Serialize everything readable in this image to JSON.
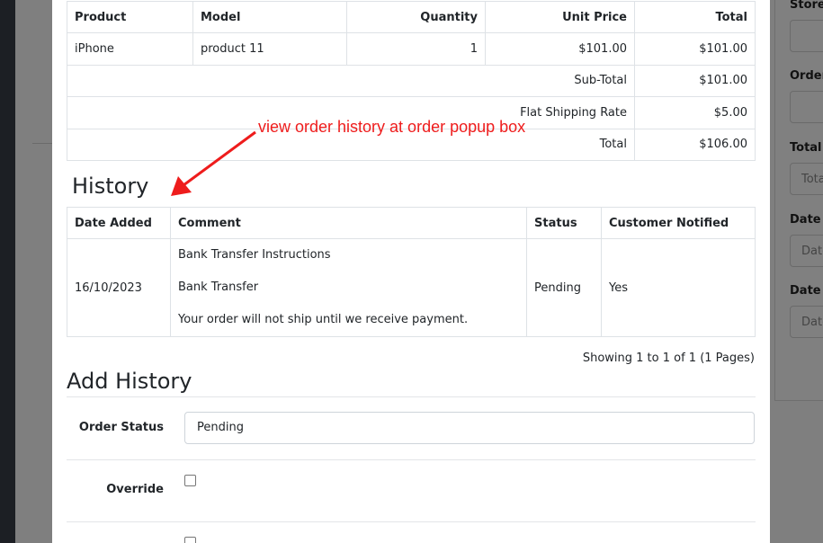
{
  "products_table": {
    "headers": {
      "product": "Product",
      "model": "Model",
      "quantity": "Quantity",
      "unit_price": "Unit Price",
      "total": "Total"
    },
    "rows": [
      {
        "product": "iPhone",
        "model": "product 11",
        "quantity": "1",
        "unit_price": "$101.00",
        "total": "$101.00"
      }
    ],
    "totals": [
      {
        "label": "Sub-Total",
        "value": "$101.00"
      },
      {
        "label": "Flat Shipping Rate",
        "value": "$5.00"
      },
      {
        "label": "Total",
        "value": "$106.00"
      }
    ]
  },
  "annotation": {
    "text": "view order history at order popup box",
    "color": "#ee1c1c"
  },
  "history": {
    "title": "History",
    "headers": {
      "date_added": "Date Added",
      "comment": "Comment",
      "status": "Status",
      "customer_notified": "Customer Notified"
    },
    "rows": [
      {
        "date_added": "16/10/2023",
        "comment_lines": [
          "Bank Transfer Instructions",
          "Bank Transfer",
          "Your order will not ship until we receive payment."
        ],
        "status": "Pending",
        "customer_notified": "Yes"
      }
    ],
    "pagination": "Showing 1 to 1 of 1 (1 Pages)"
  },
  "add_history": {
    "title": "Add History",
    "order_status_label": "Order Status",
    "order_status_value": "Pending",
    "override_label": "Override",
    "override_checked": false,
    "notify_checked": false
  },
  "background_filters": {
    "labels": [
      "Store",
      "Order",
      "Total",
      "Date I",
      "Date T"
    ],
    "placeholders": [
      "",
      "",
      "Tota",
      "Date",
      "Date"
    ]
  }
}
